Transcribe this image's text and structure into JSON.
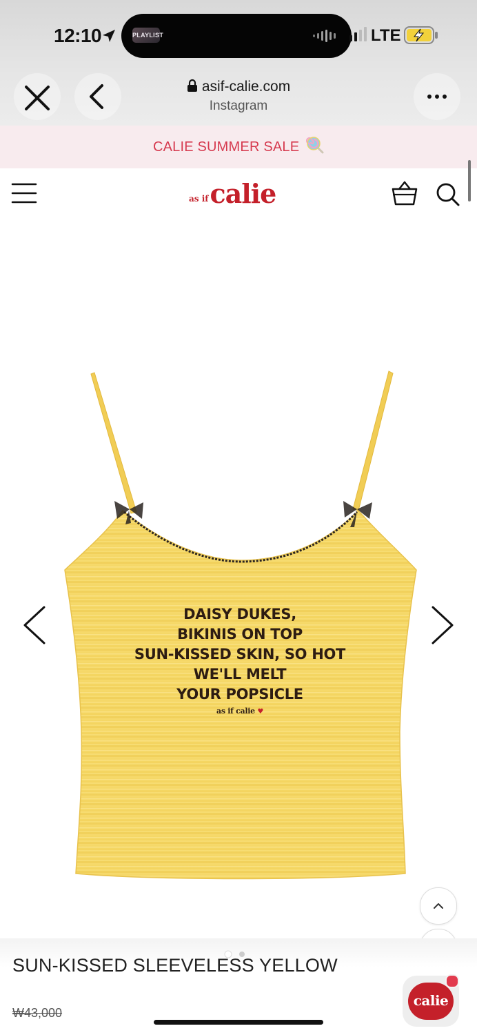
{
  "status_bar": {
    "time": "12:10",
    "island_thumb_label": "PLAYLIST",
    "network": "LTE"
  },
  "browser": {
    "url": "asif-calie.com",
    "source": "Instagram"
  },
  "banner": {
    "text": "CALIE SUMMER SALE"
  },
  "site": {
    "logo_small": "as if",
    "logo_big": "calie"
  },
  "product": {
    "image_print": [
      "DAISY DUKES,",
      "BIKINIS ON TOP",
      "SUN-KISSED SKIN, SO HOT",
      "WE'LL MELT",
      "YOUR POPSICLE"
    ],
    "image_print_mark": "as if calie",
    "title": "SUN-KISSED SLEEVELESS YELLOW",
    "price": "₩43,000",
    "image_count": 2,
    "current_image": 1
  },
  "chat": {
    "label": "calie"
  },
  "colors": {
    "brand_red": "#c4202a",
    "banner_bg": "#f8ebee",
    "banner_text": "#d63a4f",
    "shirt_yellow": "#f5d96a"
  }
}
